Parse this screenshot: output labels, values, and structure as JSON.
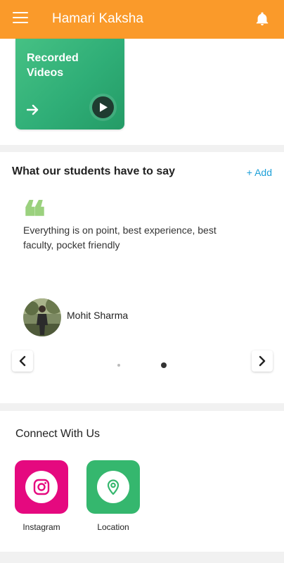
{
  "appbar": {
    "title": "Hamari Kaksha",
    "menu_icon": "menu-icon",
    "bell_icon": "bell-icon"
  },
  "recorded": {
    "label": "Recorded Videos",
    "arrow_icon": "arrow-right-icon",
    "play_icon": "play-icon"
  },
  "testimonials": {
    "heading": "What our students have to say",
    "add_label": "+ Add",
    "quote_text": "Everything is on point, best experience, best faculty, pocket friendly",
    "student_name": "Mohit Sharma",
    "pager": {
      "total": 2,
      "active": 2
    }
  },
  "connect": {
    "heading": "Connect With Us",
    "items": [
      {
        "label": "Instagram",
        "icon": "instagram-icon",
        "color": "#e5097f"
      },
      {
        "label": "Location",
        "icon": "location-pin-icon",
        "color": "#35b76e"
      }
    ]
  },
  "colors": {
    "appbar": "#fa9a2a",
    "card_green": "#2fae77",
    "quote_green": "#9bd17e",
    "add_link": "#1ea0d8"
  }
}
